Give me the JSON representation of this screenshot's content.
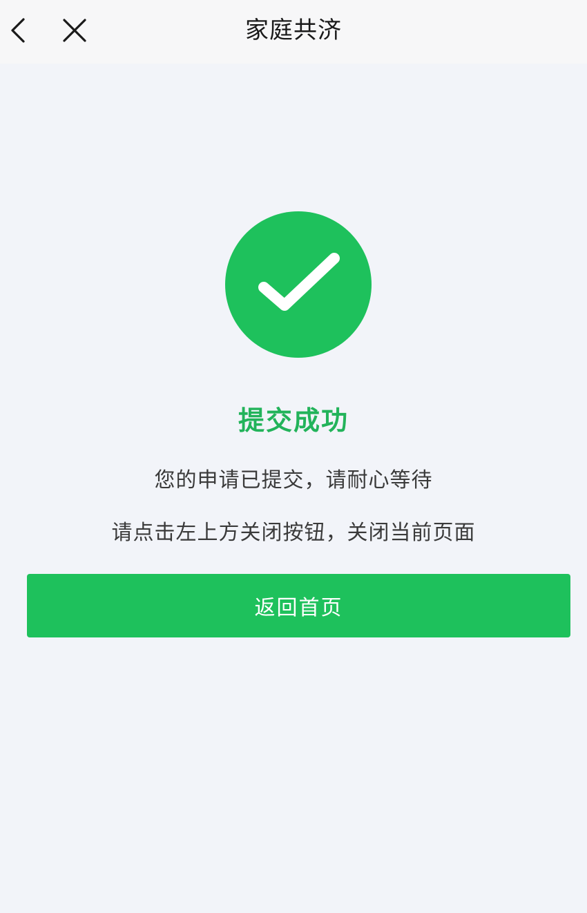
{
  "nav": {
    "title": "家庭共济",
    "back_icon": "chevron-left-icon",
    "close_icon": "close-icon"
  },
  "result": {
    "icon": "check-circle-icon",
    "title": "提交成功",
    "message_1": "您的申请已提交，请耐心等待",
    "message_2": "请点击左上方关闭按钮，关闭当前页面"
  },
  "actions": {
    "home_label": "返回首页"
  },
  "colors": {
    "accent": "#1ec15c",
    "success_text": "#22b35a",
    "background": "#f2f4f9"
  }
}
